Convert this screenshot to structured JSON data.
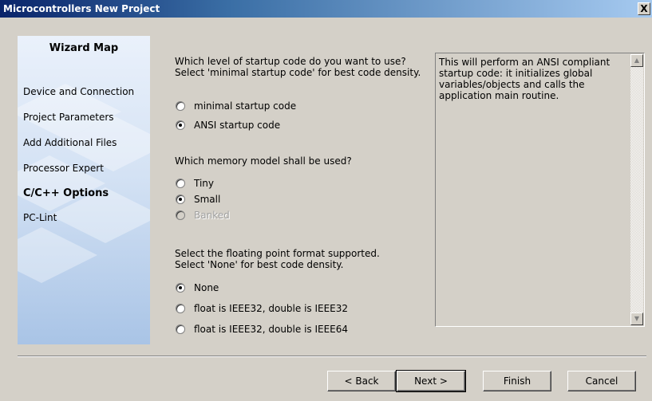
{
  "window": {
    "title": "Microcontrollers New Project",
    "close_label": "X"
  },
  "wizard_map": {
    "title": "Wizard Map",
    "items": [
      {
        "label": "Device and Connection",
        "active": false
      },
      {
        "label": "Project Parameters",
        "active": false
      },
      {
        "label": "Add Additional Files",
        "active": false
      },
      {
        "label": "Processor Expert",
        "active": false
      },
      {
        "label": "C/C++ Options",
        "active": true
      },
      {
        "label": "PC-Lint",
        "active": false
      }
    ]
  },
  "startup": {
    "question_line1": "Which level of startup code do you want to use?",
    "question_line2": "Select 'minimal startup code' for best code density.",
    "options": [
      {
        "label": "minimal startup code",
        "checked": false,
        "disabled": false
      },
      {
        "label": "ANSI startup code",
        "checked": true,
        "disabled": false
      }
    ]
  },
  "memory_model": {
    "question": "Which memory model shall be used?",
    "options": [
      {
        "label": "Tiny",
        "checked": false,
        "disabled": false
      },
      {
        "label": "Small",
        "checked": true,
        "disabled": false
      },
      {
        "label": "Banked",
        "checked": false,
        "disabled": true
      }
    ]
  },
  "floating_point": {
    "question_line1": "Select the floating point format supported.",
    "question_line2": "Select 'None' for best code density.",
    "options": [
      {
        "label": "None",
        "checked": true,
        "disabled": false
      },
      {
        "label": "float is IEEE32, double is IEEE32",
        "checked": false,
        "disabled": false
      },
      {
        "label": "float is IEEE32, double is IEEE64",
        "checked": false,
        "disabled": false
      }
    ]
  },
  "description": {
    "text": "This will perform an ANSI compliant startup code: it initializes global variables/objects and calls the application main routine."
  },
  "buttons": {
    "back": "< Back",
    "next": "Next >",
    "finish": "Finish",
    "cancel": "Cancel"
  },
  "colors": {
    "title_gradient_start": "#0a246a",
    "title_gradient_end": "#a6caf0",
    "dialog_face": "#d4d0c8"
  }
}
